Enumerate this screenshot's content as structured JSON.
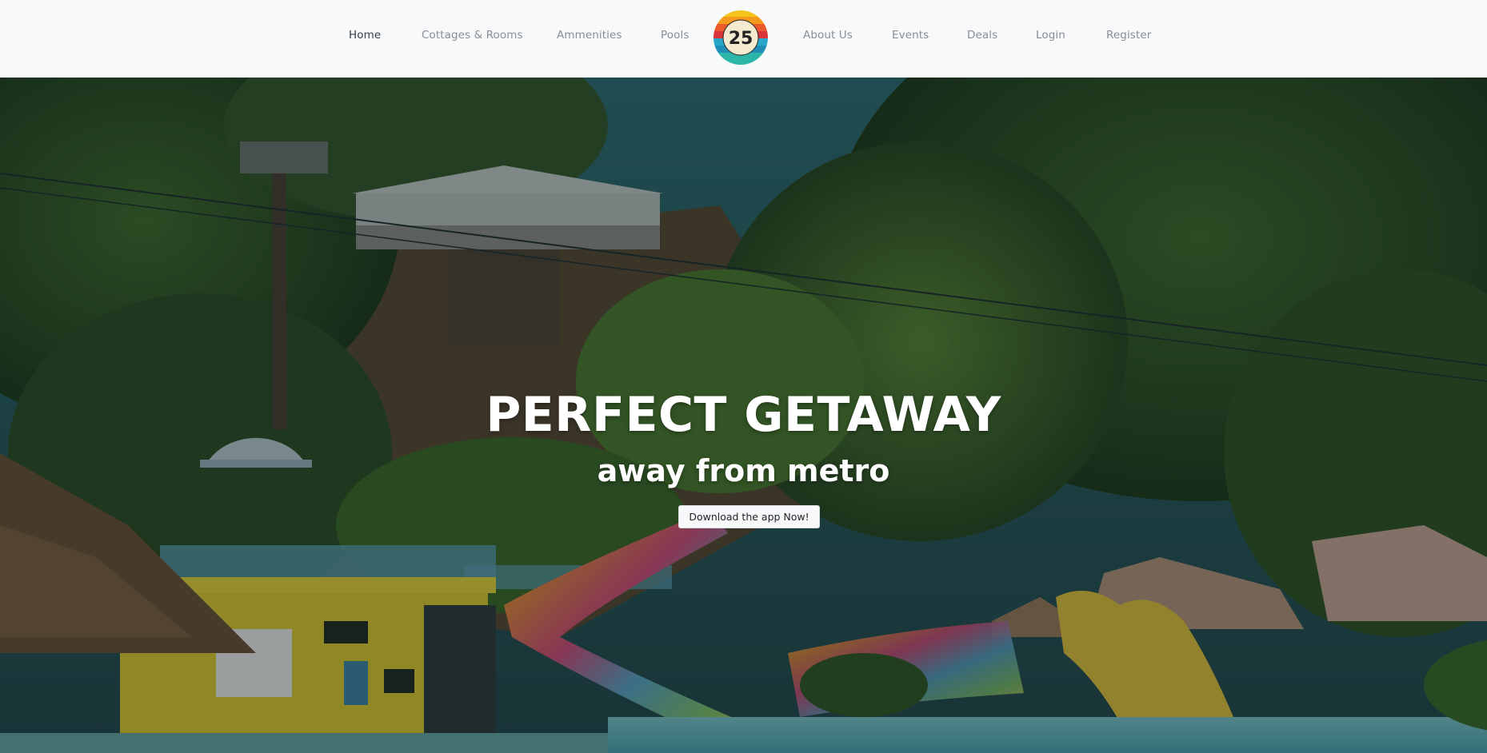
{
  "nav": {
    "items": [
      {
        "label": "Home",
        "active": true
      },
      {
        "label": "Cottages & Rooms"
      },
      {
        "label": "Ammenities"
      },
      {
        "label": "Pools"
      },
      {
        "label": "About Us"
      },
      {
        "label": "Events"
      },
      {
        "label": "Deals"
      },
      {
        "label": "Login"
      },
      {
        "label": "Register"
      }
    ],
    "logo_badge": "25"
  },
  "hero": {
    "title": "PERFECT GETAWAY",
    "subtitle": "away from metro",
    "cta_label": "Download the app Now!"
  },
  "colors": {
    "navbar_bg": "#f8f9fa",
    "nav_text": "#8a8f94",
    "nav_active": "#3a3f44",
    "hero_text": "#ffffff"
  }
}
